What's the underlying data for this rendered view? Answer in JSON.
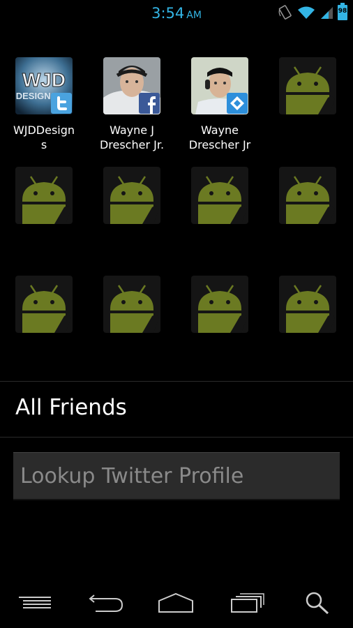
{
  "status_bar": {
    "time": "3:54",
    "ampm": "AM",
    "battery_level": "98",
    "accent_color": "#33b5e5",
    "icons": [
      "rotation-lock-icon",
      "wifi-icon",
      "signal-icon",
      "battery-icon"
    ]
  },
  "friends_grid": {
    "items": [
      {
        "name": "WJDDesign\ns",
        "avatar": "wjd-designs-logo",
        "badge": "twitter-icon"
      },
      {
        "name": "Wayne J\nDrescher Jr.",
        "avatar": "photo-man-cap",
        "badge": "facebook-icon"
      },
      {
        "name": "Wayne\nDrescher Jr",
        "avatar": "photo-man-headset",
        "badge": "foursquare-icon"
      },
      {
        "name": "",
        "avatar": "android-icon"
      },
      {
        "name": "",
        "avatar": "android-icon"
      },
      {
        "name": "",
        "avatar": "android-icon"
      },
      {
        "name": "",
        "avatar": "android-icon"
      },
      {
        "name": "",
        "avatar": "android-icon"
      },
      {
        "name": "",
        "avatar": "android-icon"
      },
      {
        "name": "",
        "avatar": "android-icon"
      },
      {
        "name": "",
        "avatar": "android-icon"
      },
      {
        "name": "",
        "avatar": "android-icon"
      }
    ]
  },
  "section": {
    "title": "All Friends"
  },
  "lookup": {
    "placeholder": "Lookup Twitter Profile",
    "value": ""
  },
  "navbar": {
    "buttons": [
      "menu-icon",
      "back-icon",
      "home-icon",
      "recent-apps-icon",
      "search-icon"
    ]
  },
  "colors": {
    "twitter": "#4aa3df",
    "facebook": "#3b5998",
    "foursquare": "#2d8fdb",
    "android_green": "#6b7a22"
  }
}
